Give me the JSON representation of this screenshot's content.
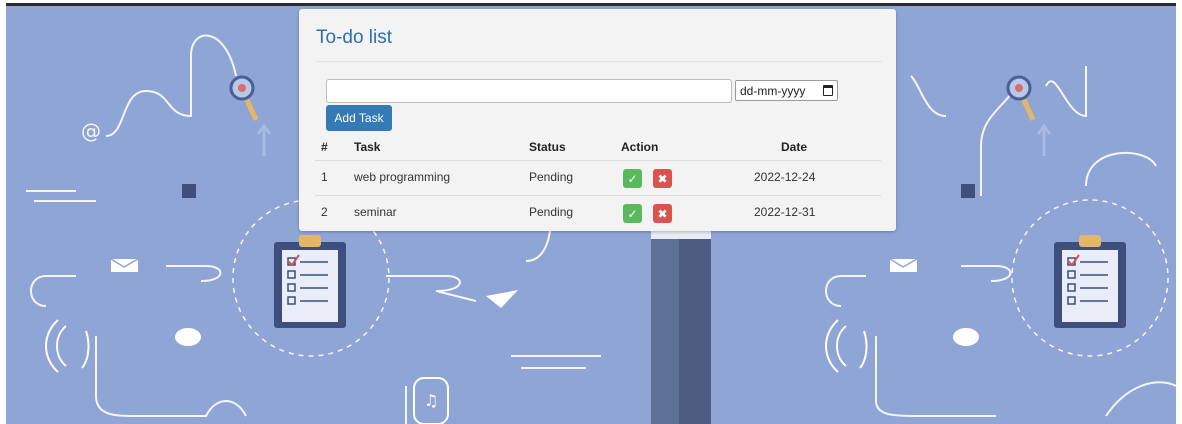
{
  "todo": {
    "title": "To-do list",
    "task_input_value": "",
    "date_placeholder": "dd-mm-yyyy",
    "add_button_label": "Add Task"
  },
  "table": {
    "headers": [
      "#",
      "Task",
      "Status",
      "Action",
      "Date"
    ],
    "rows": [
      {
        "num": "1",
        "task": "web programming",
        "status": "Pending",
        "date": "2022-12-24"
      },
      {
        "num": "2",
        "task": "seminar",
        "status": "Pending",
        "date": "2022-12-31"
      }
    ],
    "action_icons": {
      "complete": "check-square-icon",
      "delete": "x-icon"
    }
  },
  "colors": {
    "background": "#8fa5d6",
    "title": "#2f6fb0",
    "primary_button": "#337ab7",
    "success": "#5cb85c",
    "danger": "#d9534f"
  }
}
